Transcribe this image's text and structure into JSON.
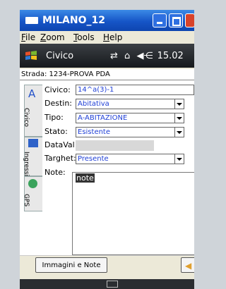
{
  "window": {
    "title": "MILANO_12"
  },
  "menu": [
    {
      "underline": "F",
      "rest": "ile"
    },
    {
      "underline": "Z",
      "rest": "oom"
    },
    {
      "underline": "T",
      "rest": "ools"
    },
    {
      "underline": "H",
      "rest": "elp"
    }
  ],
  "pda": {
    "title": "Civico",
    "time": "15.02"
  },
  "street": "Strada: 1234-PROVA PDA",
  "tabs": [
    {
      "label": "Civico",
      "icon": "letter-a-icon"
    },
    {
      "label": "Ingressi",
      "icon": "entrance-icon"
    },
    {
      "label": "GPS",
      "icon": "globe-icon"
    }
  ],
  "form": {
    "civico": {
      "label": "Civico:",
      "value": "14^a(3)-1"
    },
    "destin": {
      "label": "Destin:",
      "value": "Abitativa"
    },
    "tipo": {
      "label": "Tipo:",
      "value": "A-ABITAZIONE"
    },
    "stato": {
      "label": "Stato:",
      "value": "Esistente"
    },
    "dataval": {
      "label": "DataVal:",
      "value": ""
    },
    "targhet": {
      "label": "Targhet:",
      "value": "Presente"
    },
    "note": {
      "label": "Note:",
      "value": "note"
    }
  },
  "buttons": {
    "images_notes": "Immagini e Note"
  },
  "colors": {
    "titlebar": "#1655c7",
    "field_text": "#1f3fd6",
    "pda_bar": "#16191c"
  }
}
